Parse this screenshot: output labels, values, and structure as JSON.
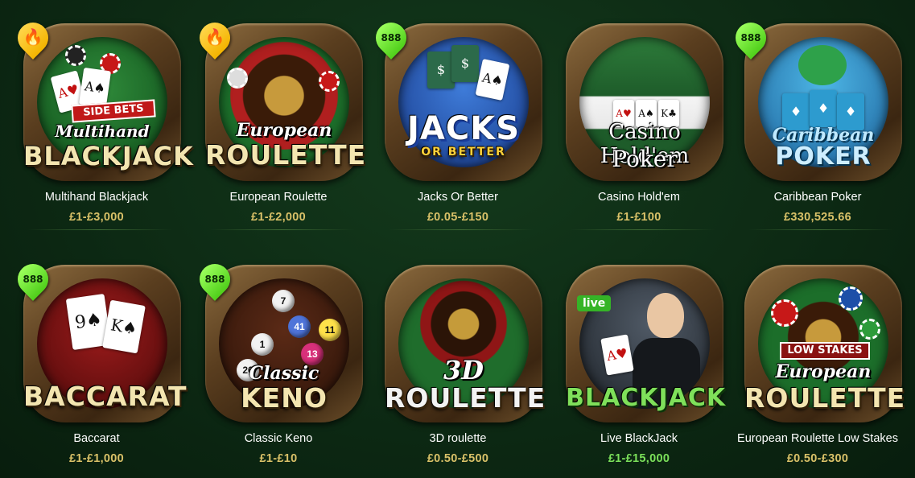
{
  "games": [
    {
      "name": "Multihand Blackjack",
      "stake": "£1-£3,000",
      "badge": "fire-icon",
      "logo_small": "Multihand",
      "logo_big": "BLACKJACK",
      "banner": "SIDE BETS"
    },
    {
      "name": "European Roulette",
      "stake": "£1-£2,000",
      "badge": "fire-icon",
      "logo_small": "European",
      "logo_big": "ROULETTE"
    },
    {
      "name": "Jacks Or Better",
      "stake": "£0.05-£150",
      "badge": "888",
      "logo_big": "JACKS",
      "logo_sub": "OR BETTER"
    },
    {
      "name": "Casino Hold'em",
      "stake": "£1-£100",
      "badge": "",
      "logo_line1": "Casino Hold'em",
      "logo_line2": "Poker"
    },
    {
      "name": "Caribbean Poker",
      "stake": "£330,525.66",
      "badge": "888",
      "logo_small": "Caribbean",
      "logo_big": "POKER"
    },
    {
      "name": "Baccarat",
      "stake": "£1-£1,000",
      "badge": "888",
      "logo_big": "BACCARAT"
    },
    {
      "name": "Classic Keno",
      "stake": "£1-£10",
      "badge": "888",
      "logo_small": "Classic",
      "logo_big": "KENO"
    },
    {
      "name": "3D roulette",
      "stake": "£0.50-£500",
      "badge": "",
      "logo_small": "3D",
      "logo_big": "ROULETTE"
    },
    {
      "name": "Live BlackJack",
      "stake": "£1-£15,000",
      "badge": "",
      "live_label": "live",
      "logo_big": "BLACKJACK"
    },
    {
      "name": "European Roulette Low Stakes",
      "stake": "£0.50-£300",
      "badge": "",
      "banner": "LOW STAKES",
      "logo_small": "European",
      "logo_big": "ROULETTE"
    }
  ],
  "colors": {
    "stake": "#d9c168",
    "stake_live": "#7be05a",
    "badge_hot": "#f4b400",
    "badge_888": "#6fe22e"
  }
}
